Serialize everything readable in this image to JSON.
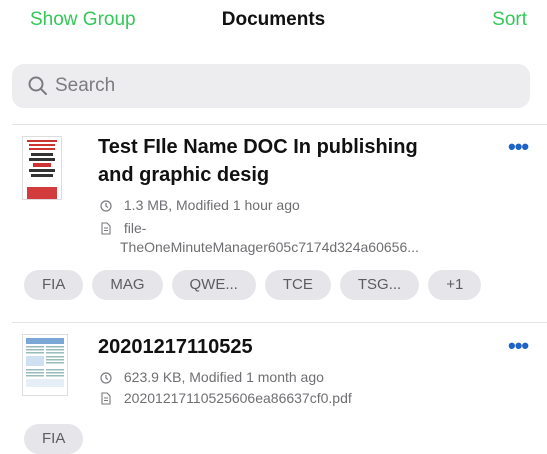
{
  "nav": {
    "left": "Show Group",
    "title": "Documents",
    "right": "Sort"
  },
  "search": {
    "placeholder": "Search"
  },
  "colors": {
    "accent_green": "#34c759",
    "more_blue": "#1d63c7",
    "tag_bg": "#e6e6ea"
  },
  "files": [
    {
      "name_line1": "Test FIle Name DOC In publishing",
      "name_line2": "and graphic desig",
      "meta": "1.3 MB, Modified 1 hour ago",
      "file_line1": "file-",
      "file_line2": "TheOneMinuteManager605c7174d324a60656...",
      "more": "•••",
      "tags": [
        "FIA",
        "MAG",
        "QWE...",
        "TCE",
        "TSG...",
        "+1"
      ]
    },
    {
      "name_line1": "20201217110525",
      "meta": "623.9 KB, Modified 1 month ago",
      "file_line1": "20201217110525606ea86637cf0.pdf",
      "more": "•••",
      "tags": [
        "FIA"
      ]
    }
  ]
}
